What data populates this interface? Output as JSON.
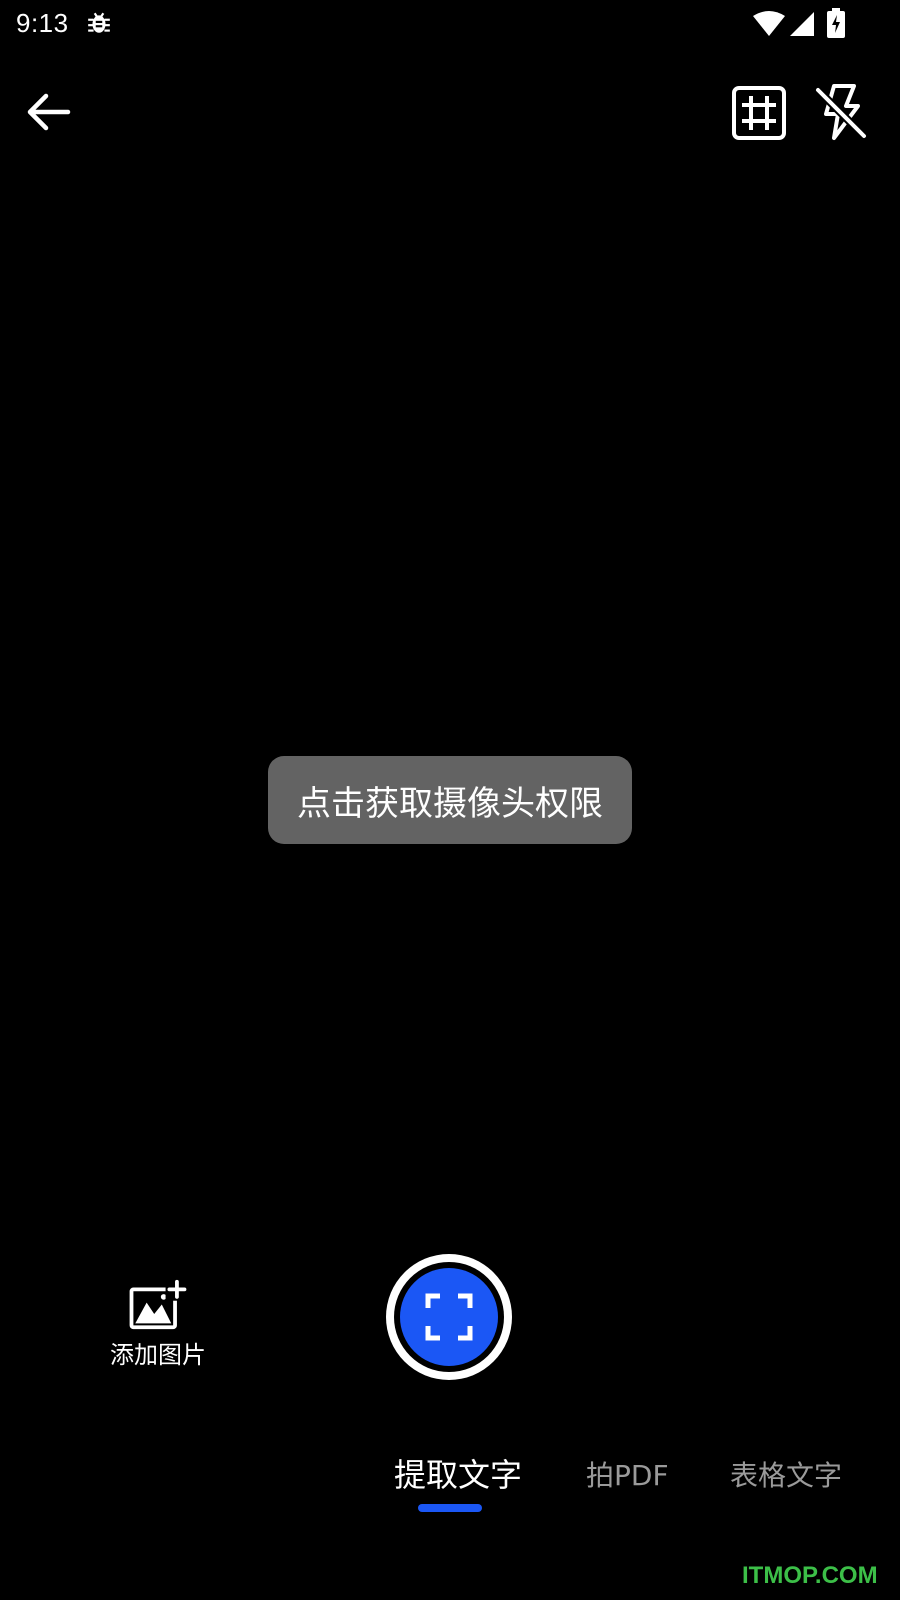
{
  "status_bar": {
    "time": "9:13",
    "icons": [
      "bug-icon",
      "wifi-icon",
      "signal-icon",
      "battery-charging-icon"
    ]
  },
  "toolbar": {
    "back_icon": "arrow-left-icon",
    "grid_icon": "grid-icon",
    "flash_icon": "flash-off-icon"
  },
  "camera": {
    "permission_button_label": "点击获取摄像头权限"
  },
  "controls": {
    "add_image_label": "添加图片",
    "add_image_icon": "add-photo-icon",
    "shutter_icon": "scan-frame-icon"
  },
  "modes": {
    "tabs": [
      {
        "label": "提取文字",
        "active": true
      },
      {
        "label": "拍PDF",
        "active": false
      },
      {
        "label": "表格文字",
        "active": false
      }
    ]
  },
  "watermark": {
    "text": "ITMOP.COM"
  },
  "colors": {
    "background": "#000000",
    "accent": "#1b57f5",
    "permission_button_bg": "#636363",
    "inactive_tab": "#9a9a9a",
    "watermark": "#3cbf48"
  }
}
